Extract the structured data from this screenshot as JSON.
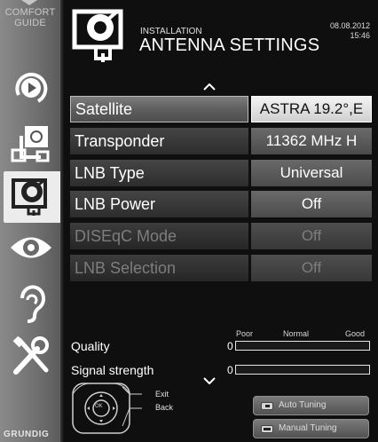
{
  "sidebar": {
    "guide_line1": "COMFORT",
    "guide_line2": "GUIDE",
    "brand": "GRUNDIG"
  },
  "header": {
    "section": "INSTALLATION",
    "title": "ANTENNA SETTINGS",
    "date": "08.08.2012",
    "time": "15:46"
  },
  "menu": [
    {
      "label": "Satellite",
      "value": "ASTRA 19.2°,E",
      "state": "selected"
    },
    {
      "label": "Transponder",
      "value": "11362 MHz H",
      "state": "normal"
    },
    {
      "label": "LNB Type",
      "value": "Universal",
      "state": "normal"
    },
    {
      "label": "LNB Power",
      "value": "Off",
      "state": "normal"
    },
    {
      "label": "DISEqC Mode",
      "value": "Off",
      "state": "disabled"
    },
    {
      "label": "LNB Selection",
      "value": "Off",
      "state": "disabled"
    }
  ],
  "signal": {
    "scale_poor": "Poor",
    "scale_normal": "Normal",
    "scale_good": "Good",
    "quality_label": "Quality",
    "quality_value": "0",
    "quality_level": 0,
    "strength_label": "Signal strength",
    "strength_value": "0",
    "strength_level": 0
  },
  "footer": {
    "ok_label": "OK",
    "exit_label": "Exit",
    "back_label": "Back",
    "auto_tuning": "Auto Tuning",
    "manual_tuning": "Manual Tuning"
  },
  "colors": {
    "selected_value_bg": "#e8e8e8",
    "disabled_text": "#7d7d7d"
  }
}
